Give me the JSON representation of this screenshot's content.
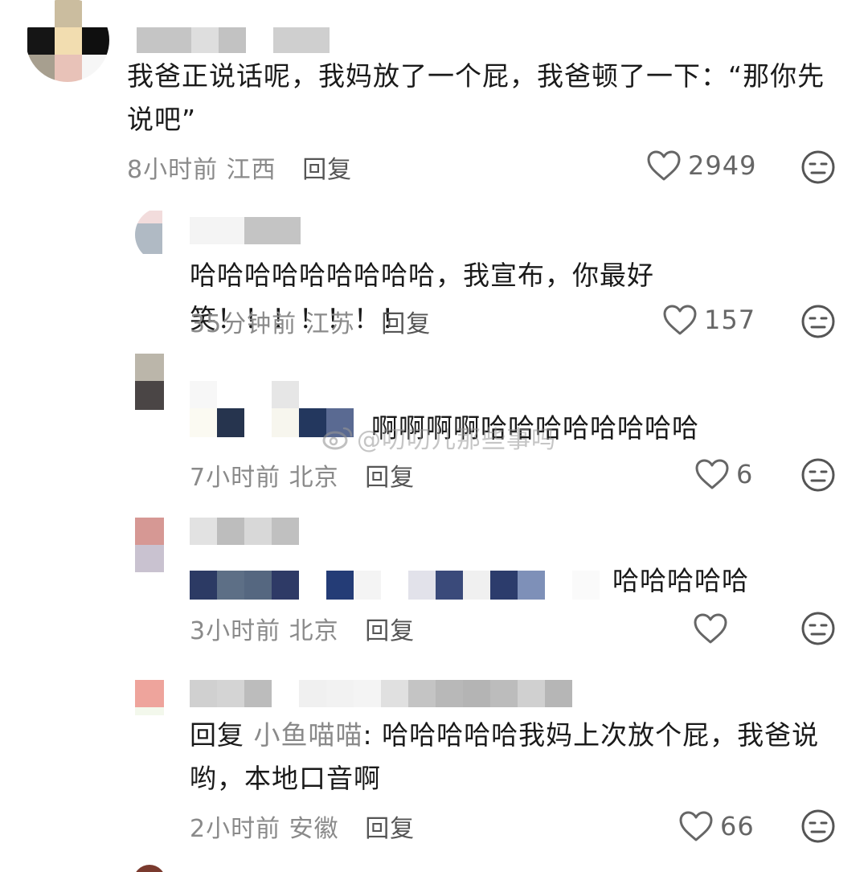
{
  "comments": [
    {
      "text": "我爸正说话呢，我妈放了一个屁，我爸顿了一下：“那你先说吧”",
      "time": "8小时前",
      "location": "江西",
      "reply_label": "回复",
      "likes": "2949"
    },
    {
      "text": "哈哈哈哈哈哈哈哈哈，我宣布，你最好笑！！！！！！！",
      "time": "35分钟前",
      "location": "江苏",
      "reply_label": "回复",
      "likes": "157"
    },
    {
      "text": "啊啊啊啊哈哈哈哈哈哈哈哈",
      "time": "7小时前",
      "location": "北京",
      "reply_label": "回复",
      "likes": "6"
    },
    {
      "text": "哈哈哈哈哈",
      "time": "3小时前",
      "location": "北京",
      "reply_label": "回复",
      "likes": ""
    },
    {
      "reply_prefix": "回复",
      "mention": "小鱼喵喵",
      "text_line1": ": 哈哈哈哈哈我妈上次放个屁，我爸说",
      "text_line2": "哟，本地口音啊",
      "time": "2小时前",
      "location": "安徽",
      "reply_label": "回复",
      "likes": "66"
    }
  ],
  "watermark": "@叨叨儿那些事吗",
  "icons": {
    "like": "heart-outline-icon",
    "dislike": "meh-face-icon"
  },
  "colors": {
    "text": "#1a1a1a",
    "meta": "#8a8a8a",
    "icon": "#666666"
  }
}
